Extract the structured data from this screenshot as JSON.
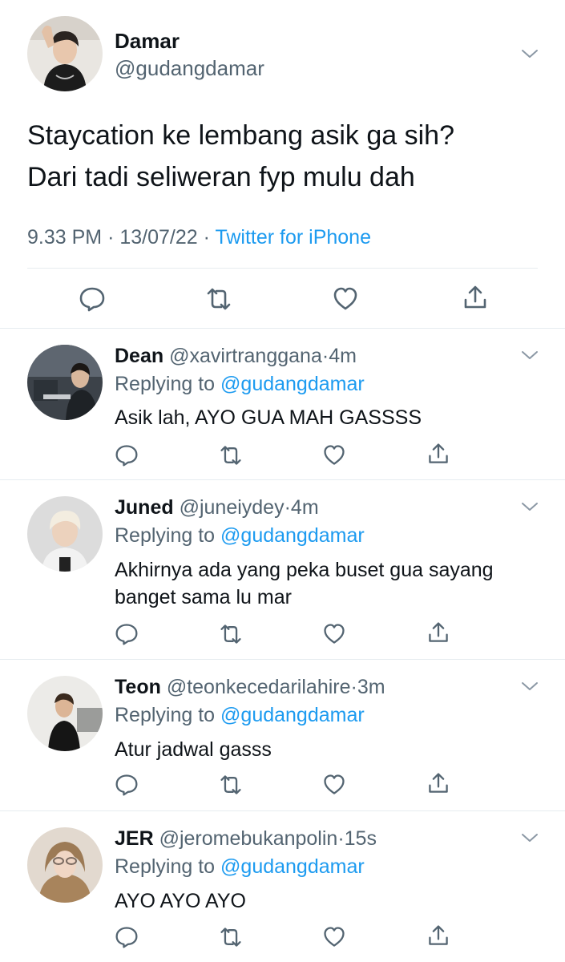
{
  "main_tweet": {
    "name": "Damar",
    "handle": "@gudangdamar",
    "text_line1": "Staycation ke lembang asik ga sih?",
    "text_line2": "Dari tadi seliweran fyp mulu dah",
    "time": "9.33 PM",
    "date": "13/07/22",
    "separator": "·",
    "source": "Twitter for iPhone"
  },
  "replies": [
    {
      "name": "Dean",
      "handle": "@xavirtranggana",
      "time": "4m",
      "replying_label": "Replying to",
      "mention": "@gudangdamar",
      "text": "Asik lah, AYO GUA MAH GASSSS"
    },
    {
      "name": "Juned",
      "handle": "@juneiydey",
      "time": "4m",
      "replying_label": "Replying to",
      "mention": "@gudangdamar",
      "text": "Akhirnya ada yang peka buset gua sayang banget sama lu mar"
    },
    {
      "name": "Teon",
      "handle": "@teonkecedarilahire",
      "time": "3m",
      "replying_label": "Replying to",
      "mention": "@gudangdamar",
      "text": "Atur jadwal gasss"
    },
    {
      "name": "JER",
      "handle": "@jeromebukanpolin",
      "time": "15s",
      "replying_label": "Replying to",
      "mention": "@gudangdamar",
      "text": "AYO AYO AYO"
    }
  ],
  "colors": {
    "text": "#0f1419",
    "secondary": "#536471",
    "accent": "#1d9bf0",
    "divider": "#e6ecf0"
  },
  "icons": [
    "reply-icon",
    "retweet-icon",
    "like-icon",
    "share-icon",
    "chevron-down-icon"
  ]
}
